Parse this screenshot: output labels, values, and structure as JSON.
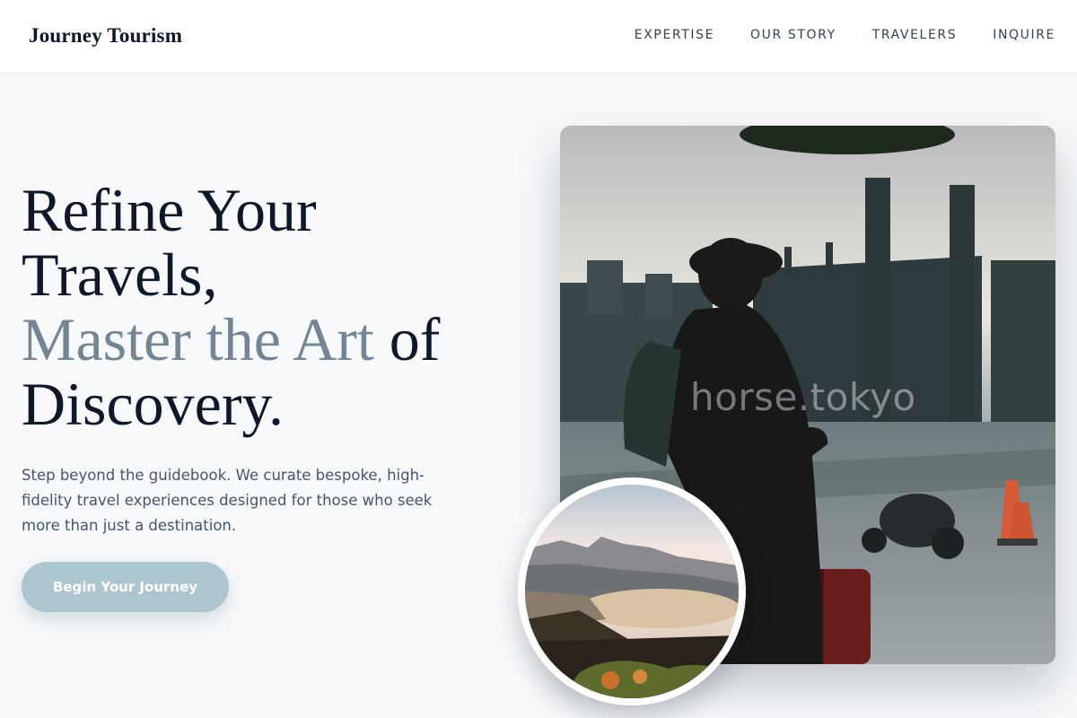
{
  "nav": {
    "brand": "Journey Tourism",
    "links": [
      "EXPERTISE",
      "OUR STORY",
      "TRAVELERS",
      "INQUIRE"
    ]
  },
  "hero": {
    "headline_part1": "Refine Your Travels,",
    "headline_accent": "Master the Art",
    "headline_part2": "of Discovery.",
    "subtext": "Step beyond the guidebook. We curate bespoke, high-fidelity travel experiences designed for those who seek more than just a destination.",
    "cta_label": "Begin Your Journey"
  },
  "images": {
    "main_watermark": "horse.tokyo"
  },
  "colors": {
    "accent_text": "#748596",
    "cta_background": "#adc5cf",
    "page_background": "#f7f9fb",
    "headline": "#0f172a"
  }
}
